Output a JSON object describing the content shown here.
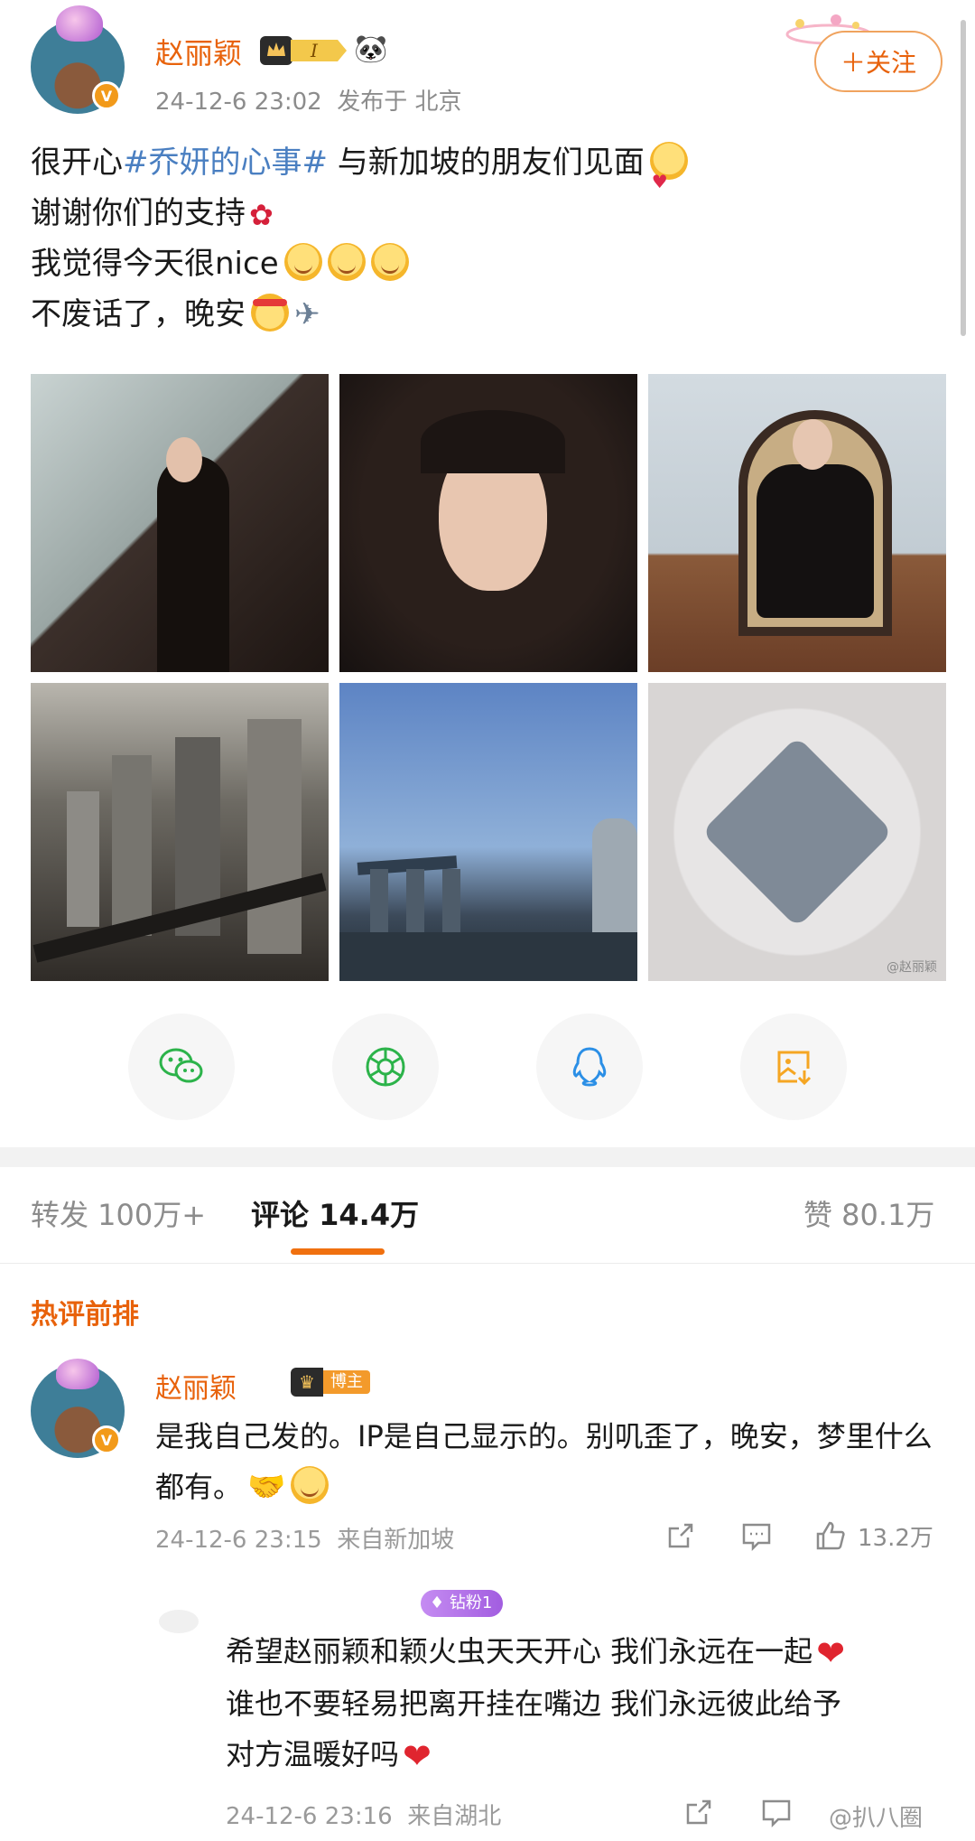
{
  "post": {
    "username": "赵丽颖",
    "level_badge": "I",
    "timestamp": "24-12-6 23:02",
    "location": "发布于 北京",
    "follow_label": "＋关注",
    "lines": {
      "l1_before": "很开心",
      "l1_hashtag": "#乔妍的心事#",
      "l1_after": " 与新加坡的朋友们见面",
      "l2": "谢谢你们的支持",
      "l3": "我觉得今天很nice",
      "l4": "不废话了，晚安"
    },
    "image_watermark": "@赵丽颖"
  },
  "share": {
    "items": [
      "wechat-icon",
      "moments-icon",
      "qq-icon",
      "save-image-icon"
    ],
    "colors": {
      "wechat": "#2cb34a",
      "moments": "#2cb34a",
      "qq": "#2b8fe6",
      "save": "#f5a623"
    }
  },
  "tabs": {
    "repost": "转发 100万+",
    "comments": "评论 14.4万",
    "likes": "赞 80.1万"
  },
  "hot_comments_label": "热评前排",
  "comment": {
    "username": "赵丽颖",
    "badge": "博主",
    "text": "是我自己发的。IP是自己显示的。别叽歪了，晚安，梦里什么都有。",
    "timestamp": "24-12-6 23:15",
    "location": "来自新加坡",
    "likes": "13.2万"
  },
  "reply": {
    "fan_badge": "钻粉1",
    "line1": "希望赵丽颖和颖火虫天天开心 我们永远在一起",
    "line2": "谁也不要轻易把离开挂在嘴边 我们永远彼此给予",
    "line3": "对方温暖好吗",
    "timestamp": "24-12-6 23:16",
    "location": "来自湖北"
  },
  "watermark": "@扒八圈"
}
